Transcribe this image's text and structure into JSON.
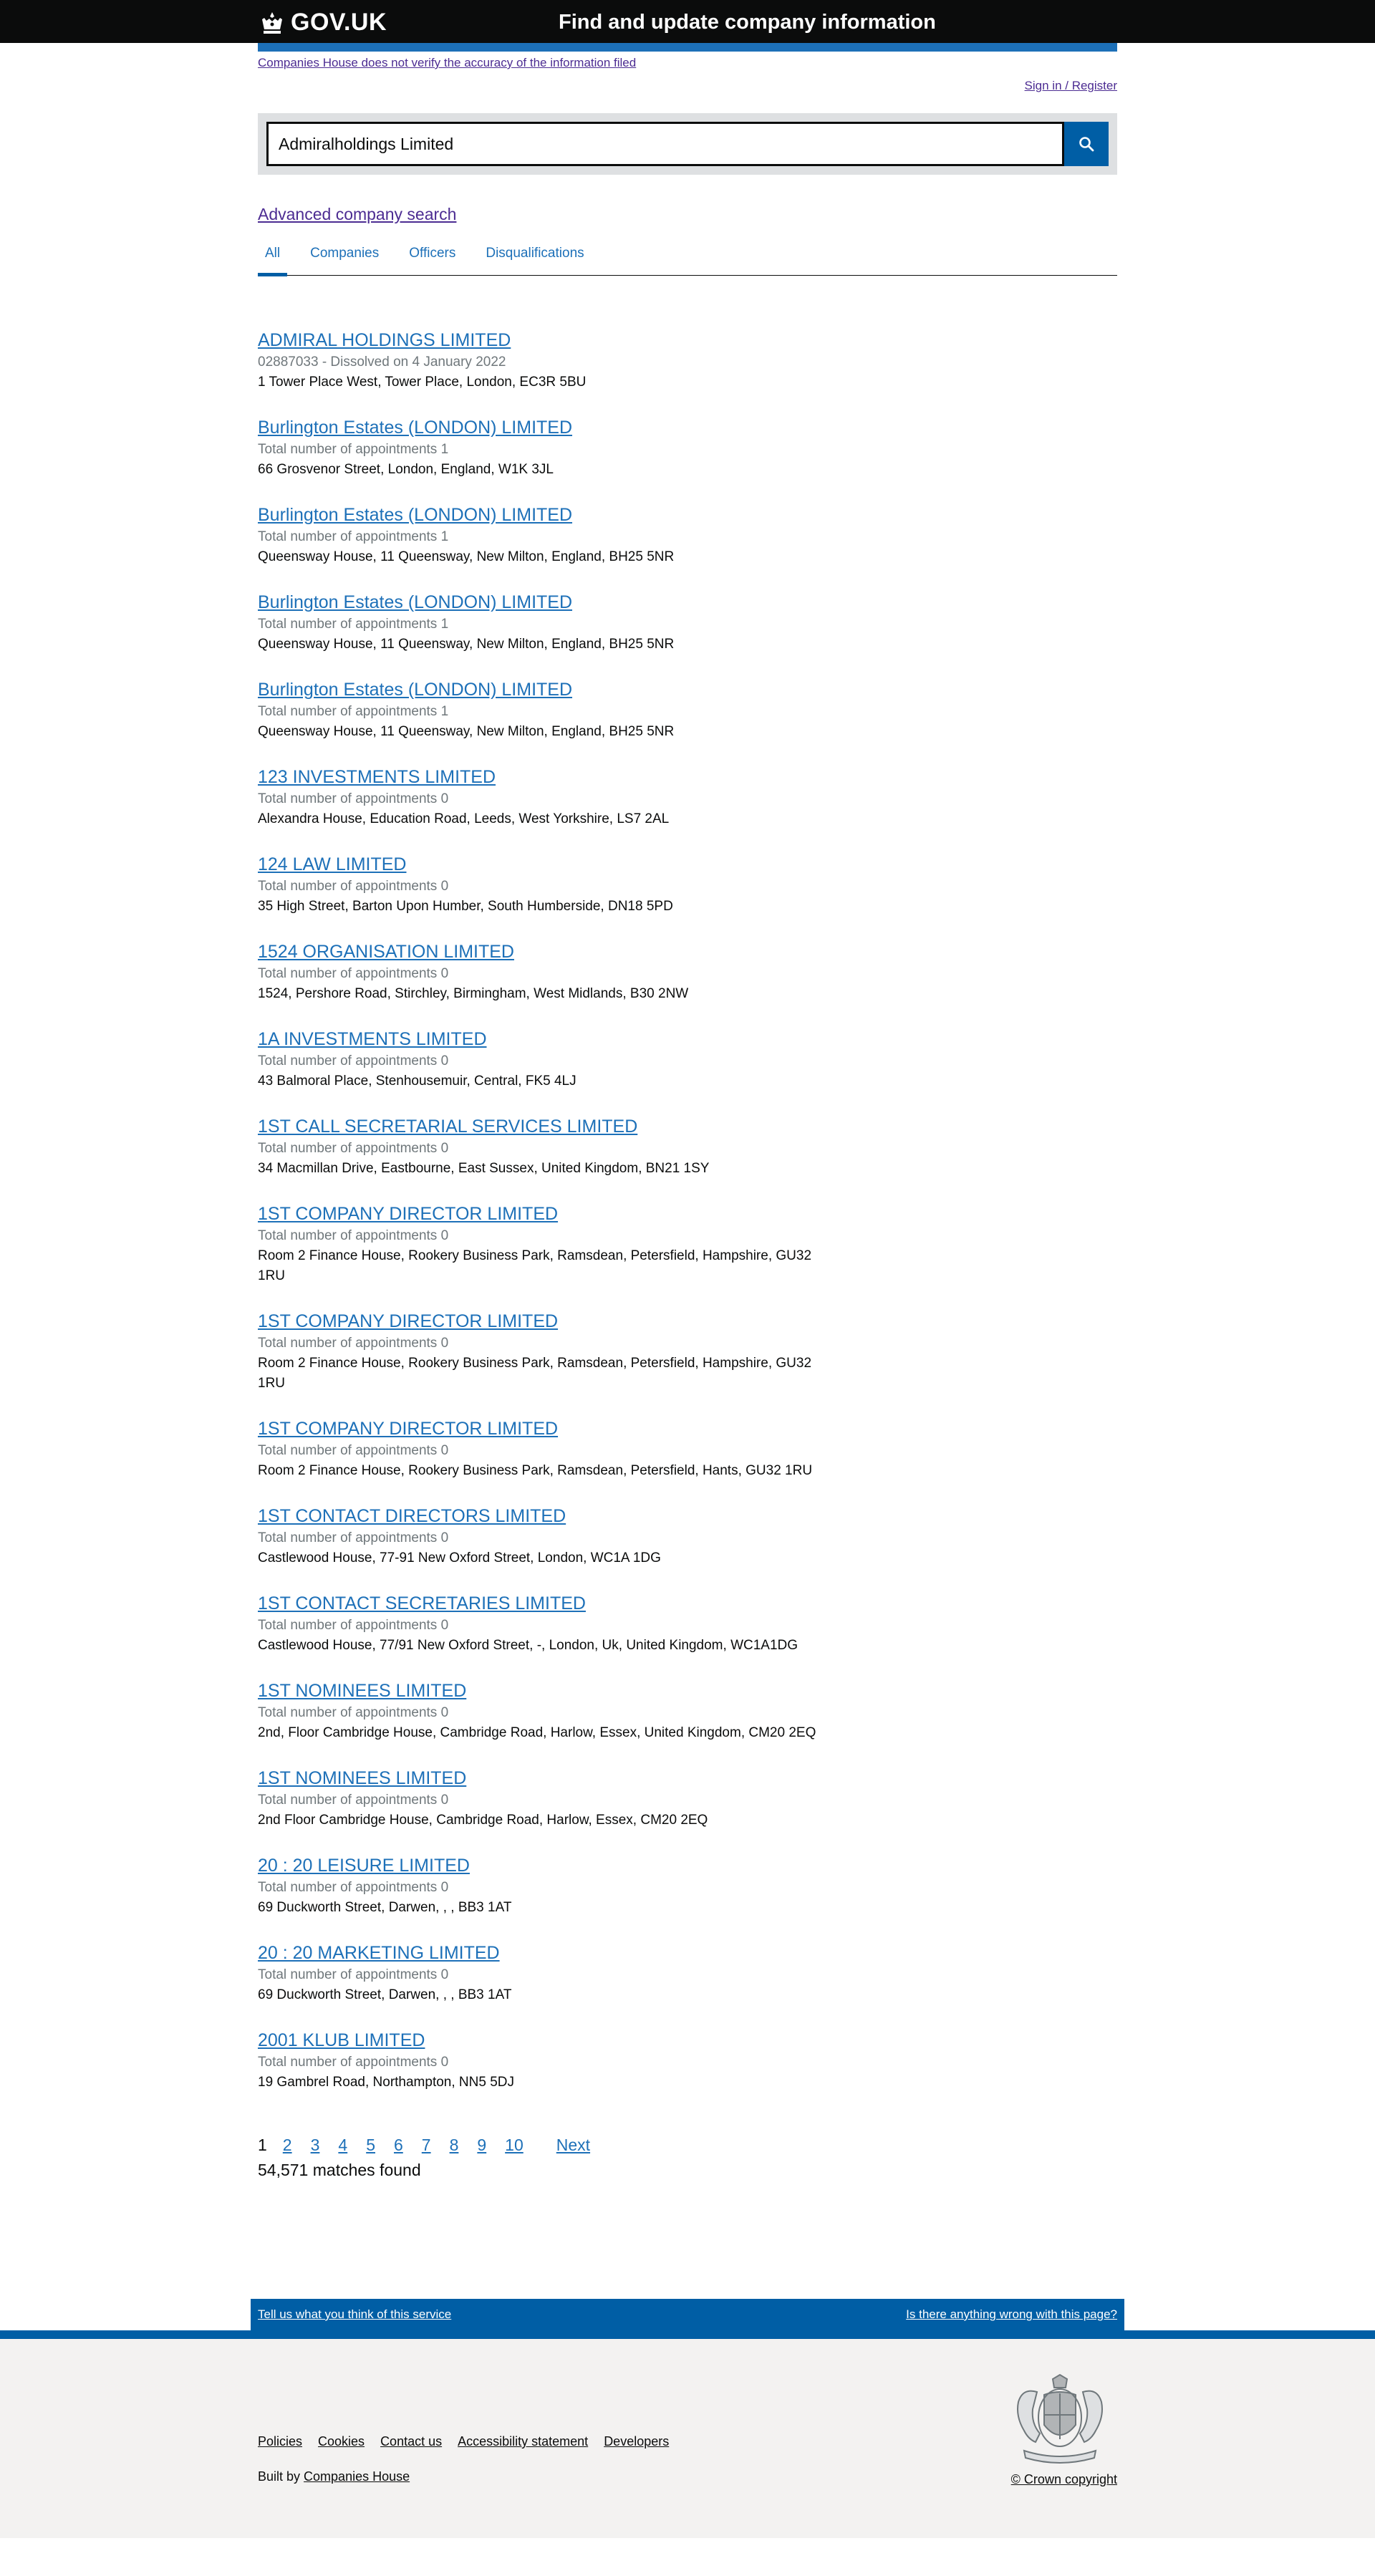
{
  "header": {
    "logo_text": "GOV.UK",
    "service_name": "Find and update company information"
  },
  "top": {
    "disclaimer": "Companies House does not verify the accuracy of the information filed",
    "sign_in": "Sign in / Register"
  },
  "search": {
    "value": "Admiralholdings Limited",
    "button_icon": "search-icon"
  },
  "advanced_search": "Advanced company search",
  "tabs": [
    {
      "label": "All",
      "active": true
    },
    {
      "label": "Companies",
      "active": false
    },
    {
      "label": "Officers",
      "active": false
    },
    {
      "label": "Disqualifications",
      "active": false
    }
  ],
  "results": [
    {
      "title": "ADMIRAL HOLDINGS LIMITED",
      "meta": "02887033 - Dissolved on 4 January 2022",
      "address": "1 Tower Place West, Tower Place, London, EC3R 5BU"
    },
    {
      "title": "Burlington Estates (LONDON) LIMITED",
      "meta": "Total number of appointments 1",
      "address": "66 Grosvenor Street, London, England, W1K 3JL"
    },
    {
      "title": "Burlington Estates (LONDON) LIMITED",
      "meta": "Total number of appointments 1",
      "address": "Queensway House, 11 Queensway, New Milton, England, BH25 5NR"
    },
    {
      "title": "Burlington Estates (LONDON) LIMITED",
      "meta": "Total number of appointments 1",
      "address": "Queensway House, 11 Queensway, New Milton, England, BH25 5NR"
    },
    {
      "title": "Burlington Estates (LONDON) LIMITED",
      "meta": "Total number of appointments 1",
      "address": "Queensway House, 11 Queensway, New Milton, England, BH25 5NR"
    },
    {
      "title": "123 INVESTMENTS LIMITED",
      "meta": "Total number of appointments 0",
      "address": "Alexandra House, Education Road, Leeds, West Yorkshire, LS7 2AL"
    },
    {
      "title": "124 LAW LIMITED",
      "meta": "Total number of appointments 0",
      "address": "35 High Street, Barton Upon Humber, South Humberside, DN18 5PD"
    },
    {
      "title": "1524 ORGANISATION LIMITED",
      "meta": "Total number of appointments 0",
      "address": "1524, Pershore Road, Stirchley, Birmingham, West Midlands, B30 2NW"
    },
    {
      "title": "1A INVESTMENTS LIMITED",
      "meta": "Total number of appointments 0",
      "address": "43 Balmoral Place, Stenhousemuir, Central, FK5 4LJ"
    },
    {
      "title": "1ST CALL SECRETARIAL SERVICES LIMITED",
      "meta": "Total number of appointments 0",
      "address": "34 Macmillan Drive, Eastbourne, East Sussex, United Kingdom, BN21 1SY"
    },
    {
      "title": "1ST COMPANY DIRECTOR LIMITED",
      "meta": "Total number of appointments 0",
      "address": "Room 2 Finance House, Rookery Business Park, Ramsdean, Petersfield, Hampshire, GU32 1RU"
    },
    {
      "title": "1ST COMPANY DIRECTOR LIMITED",
      "meta": "Total number of appointments 0",
      "address": "Room 2 Finance House, Rookery Business Park, Ramsdean, Petersfield, Hampshire, GU32 1RU"
    },
    {
      "title": "1ST COMPANY DIRECTOR LIMITED",
      "meta": "Total number of appointments 0",
      "address": "Room 2 Finance House, Rookery Business Park, Ramsdean, Petersfield, Hants, GU32 1RU"
    },
    {
      "title": "1ST CONTACT DIRECTORS LIMITED",
      "meta": "Total number of appointments 0",
      "address": "Castlewood House, 77-91 New Oxford Street, London, WC1A 1DG"
    },
    {
      "title": "1ST CONTACT SECRETARIES LIMITED",
      "meta": "Total number of appointments 0",
      "address": "Castlewood House, 77/91 New Oxford Street, -, London, Uk, United Kingdom, WC1A1DG"
    },
    {
      "title": "1ST NOMINEES LIMITED",
      "meta": "Total number of appointments 0",
      "address": "2nd, Floor Cambridge House, Cambridge Road, Harlow, Essex, United Kingdom, CM20 2EQ"
    },
    {
      "title": "1ST NOMINEES LIMITED",
      "meta": "Total number of appointments 0",
      "address": "2nd Floor Cambridge House, Cambridge Road, Harlow, Essex, CM20 2EQ"
    },
    {
      "title": "20 : 20 LEISURE LIMITED",
      "meta": "Total number of appointments 0",
      "address": "69 Duckworth Street, Darwen, , , BB3 1AT"
    },
    {
      "title": "20 : 20 MARKETING LIMITED",
      "meta": "Total number of appointments 0",
      "address": "69 Duckworth Street, Darwen, , , BB3 1AT"
    },
    {
      "title": "2001 KLUB LIMITED",
      "meta": "Total number of appointments 0",
      "address": "19 Gambrel Road, Northampton, NN5 5DJ"
    }
  ],
  "pagination": {
    "current": "1",
    "pages": [
      "2",
      "3",
      "4",
      "5",
      "6",
      "7",
      "8",
      "9",
      "10"
    ],
    "next": "Next",
    "matches": "54,571 matches found"
  },
  "feedback": {
    "left": "Tell us what you think of this service",
    "right": "Is there anything wrong with this page?"
  },
  "footer": {
    "links": [
      "Policies",
      "Cookies",
      "Contact us",
      "Accessibility statement",
      "Developers"
    ],
    "built_by_prefix": "Built by",
    "built_by_link": "Companies House",
    "copyright": "© Crown copyright",
    "crest_icon": "royal-crest-icon"
  }
}
